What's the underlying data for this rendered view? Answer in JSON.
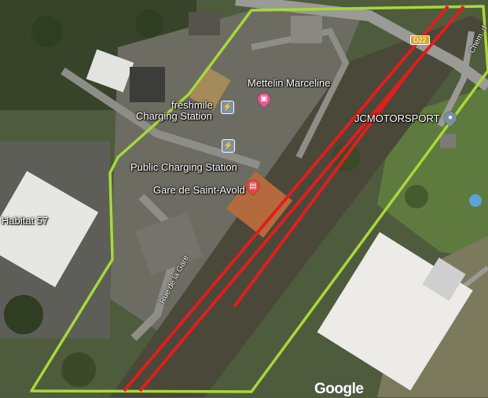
{
  "map": {
    "labels": {
      "poi_hotel": "Mettelin Marceline",
      "poi_charging_1_line1": "freshmile",
      "poi_charging_1_line2": "Charging Station",
      "poi_motorsport": "JCMOTORSPORT",
      "poi_charging_2": "Public Charging Station",
      "poi_station": "Gare de Saint-Avold",
      "poi_habitat": "Habitat 57",
      "street_gare": "Rue de la Gare",
      "street_chem": "Chem. d",
      "road_d22": "D22"
    },
    "overlay_colors": {
      "boundary": "#a8d83a",
      "track": "#e01e1e"
    },
    "attribution": "Google"
  }
}
